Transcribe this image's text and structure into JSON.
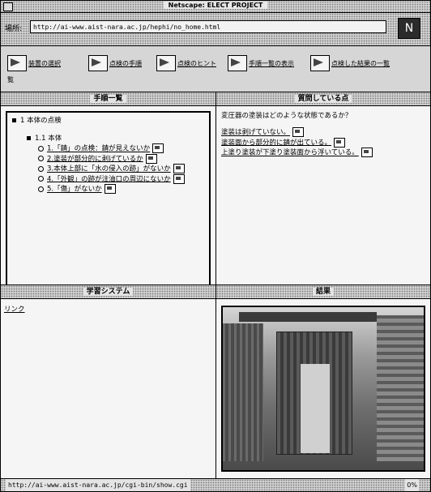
{
  "window": {
    "title": "Netscape: ELECT PROJECT"
  },
  "location": {
    "label": "場所:",
    "url": "http://ai-www.aist-nara.ac.jp/hephi/no_home.html",
    "logo": "N"
  },
  "navbar": {
    "items": [
      {
        "label": "装置の選択",
        "icon": "arrow-icon"
      },
      {
        "label": "点検の手順",
        "icon": "arrow-icon"
      },
      {
        "label": "点検のヒント",
        "icon": "arrow-icon"
      },
      {
        "label": "手順一覧の表示",
        "icon": "arrow-icon"
      },
      {
        "label": "点検した結果の一覧"
      }
    ],
    "wrap": "覧"
  },
  "steps_panel": {
    "header": "手順一覧",
    "top_item": "1 本体の点検",
    "sub_heading": "1.1 本体",
    "checks": [
      "1.「錆」の点検：錆が見えないか",
      "2.塗装が部分的に剥げているか",
      "3.本体上部に「水の侵入の跡」がないか",
      "4.「外観」の跡が注油口の周辺にないか",
      "5.「傷」がないか"
    ]
  },
  "question_panel": {
    "header": "質問している点",
    "question": "変圧器の塗装はどのような状態であるか？",
    "answers": [
      "塗装は剥げていない。",
      "塗装面から部分的に錆が出ている。",
      "上塗り塗装が下塗り塗装面から浮いている。"
    ]
  },
  "learning_panel": {
    "header": "学習システム",
    "link": "リンク"
  },
  "result_panel": {
    "header": "結果",
    "image_alt": "transformer-photo"
  },
  "status": {
    "text": "http://ai-www.aist-nara.ac.jp/cgi-bin/show.cgi",
    "percent": "0%"
  }
}
